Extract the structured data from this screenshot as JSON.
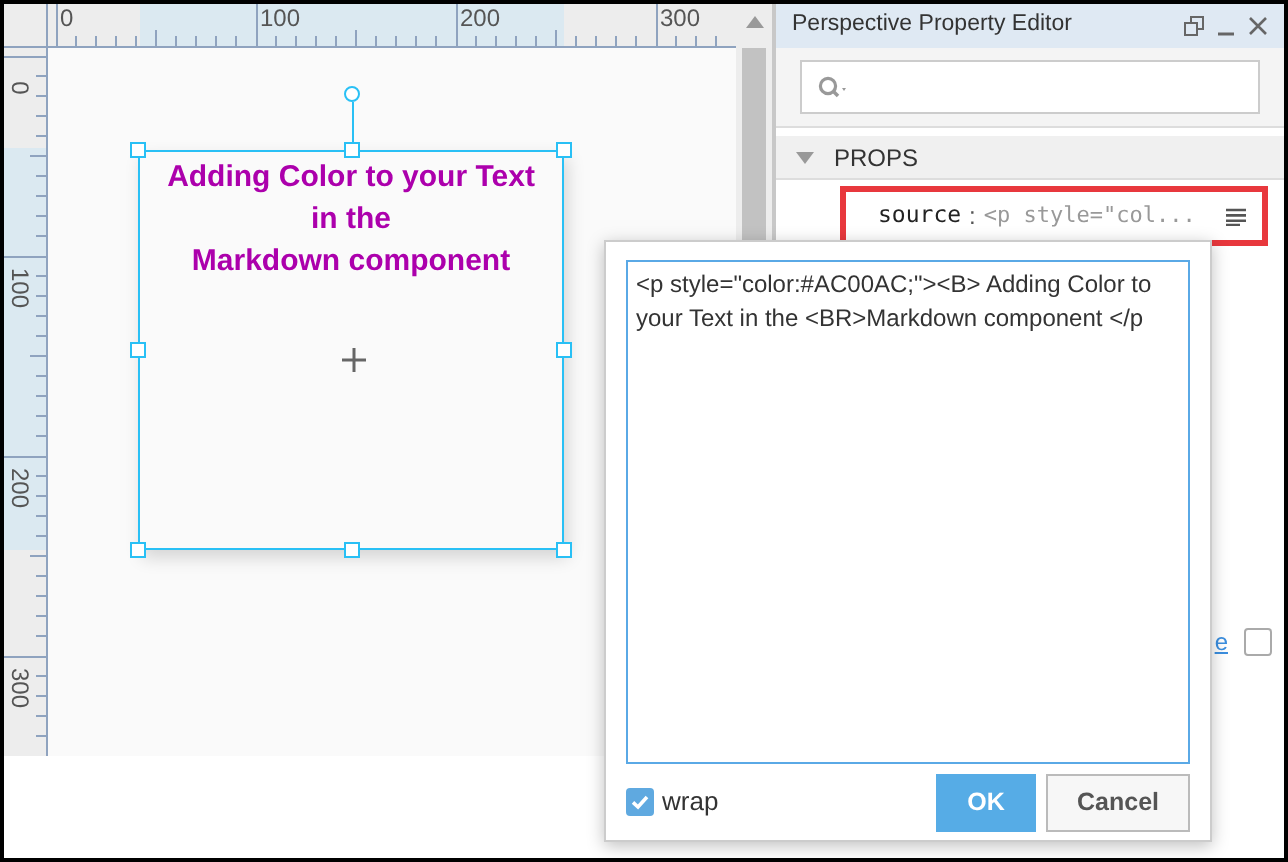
{
  "canvas": {
    "rulers": {
      "horizontal": [
        "0",
        "100",
        "200",
        "300"
      ],
      "vertical": [
        "0",
        "100",
        "200",
        "300"
      ]
    },
    "component": {
      "lines": [
        "Adding Color to your Text",
        "in the",
        "Markdown component"
      ],
      "selected": true
    }
  },
  "panel": {
    "title": "Perspective Property Editor",
    "section": {
      "label": "PROPS",
      "expanded": true
    },
    "property": {
      "name": "source",
      "separator": ":",
      "value": "<p style=\"col...",
      "selected": true
    },
    "link_fragment": "e",
    "checkbox": {
      "checked": false
    }
  },
  "editor": {
    "text": "<p style=\"color:#AC00AC;\"><B> Adding Color to your Text in the <BR>Markdown component </p",
    "wrap": {
      "label": "wrap",
      "checked": true
    },
    "buttons": [
      {
        "label": "OK",
        "kind": "primary"
      },
      {
        "label": "Cancel",
        "kind": "secondary"
      }
    ]
  }
}
